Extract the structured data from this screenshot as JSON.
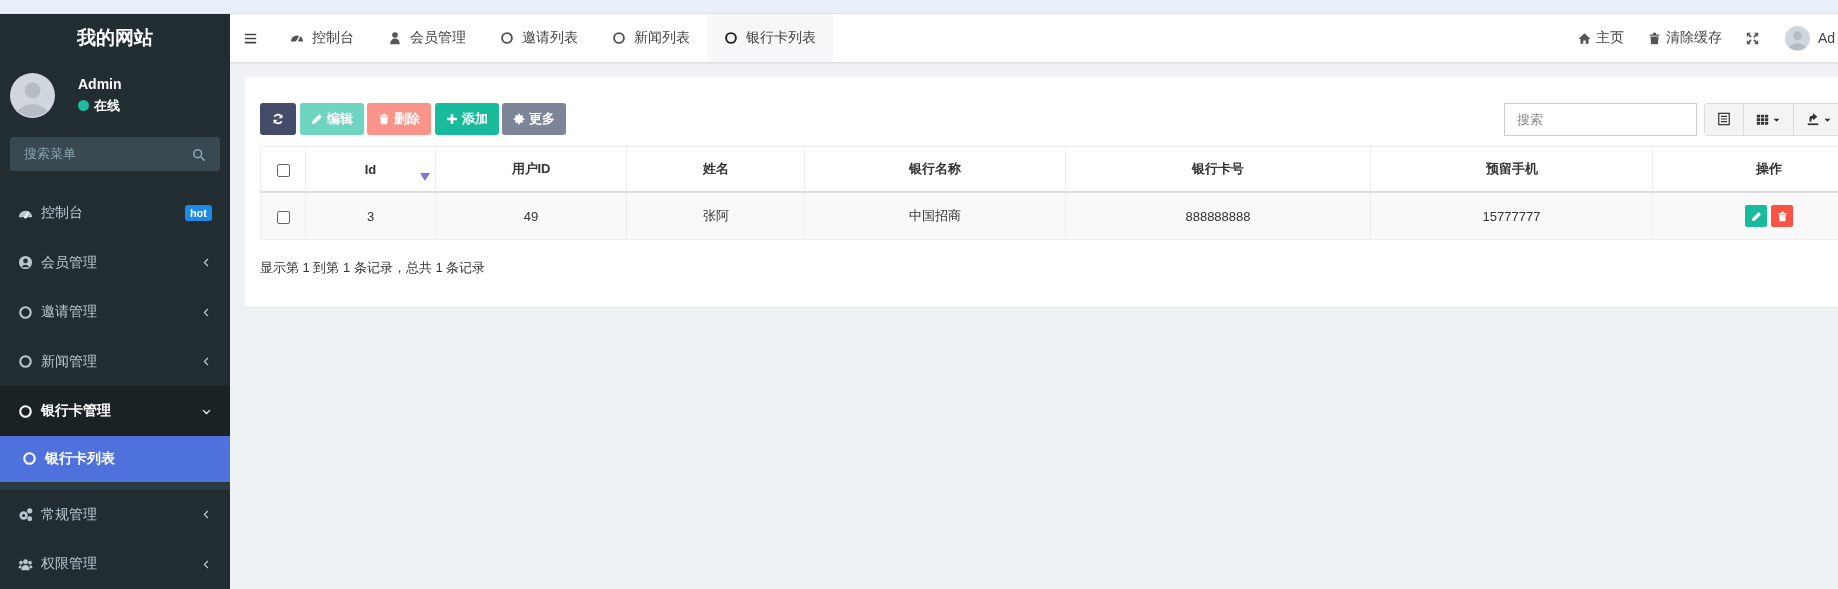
{
  "sidebar": {
    "site_title": "我的网站",
    "user": {
      "name": "Admin",
      "status": "在线"
    },
    "search": {
      "placeholder": "搜索菜单"
    },
    "items": [
      {
        "kind": "link",
        "label": "控制台",
        "badge": "hot",
        "selected": false
      },
      {
        "kind": "group",
        "label": "会员管理",
        "expanded": false,
        "selected": false
      },
      {
        "kind": "group",
        "label": "邀请管理",
        "expanded": false,
        "selected": false
      },
      {
        "kind": "group",
        "label": "新闻管理",
        "expanded": false,
        "selected": false
      },
      {
        "kind": "group",
        "label": "银行卡管理",
        "expanded": true,
        "selected": false,
        "children": [
          {
            "label": "银行卡列表",
            "selected": true
          }
        ]
      },
      {
        "kind": "group",
        "label": "常规管理",
        "expanded": false,
        "selected": false
      },
      {
        "kind": "group",
        "label": "权限管理",
        "expanded": false,
        "selected": false
      }
    ]
  },
  "header": {
    "tabs": [
      {
        "label": "控制台",
        "selected": false
      },
      {
        "label": "会员管理",
        "selected": false
      },
      {
        "label": "邀请列表",
        "selected": false
      },
      {
        "label": "新闻列表",
        "selected": false
      },
      {
        "label": "银行卡列表",
        "selected": true
      }
    ],
    "links": [
      "主页",
      "清除缓存"
    ],
    "user_name": "Ad"
  },
  "toolbar": {
    "buttons": [
      {
        "kind": "refresh",
        "disabled": false
      },
      {
        "kind": "edit",
        "label": "编辑",
        "disabled": true
      },
      {
        "kind": "delete",
        "label": "删除",
        "disabled": true
      },
      {
        "kind": "add",
        "label": "添加",
        "disabled": false
      },
      {
        "kind": "more",
        "label": "更多",
        "disabled": false
      }
    ],
    "search": {
      "placeholder": "搜索"
    }
  },
  "table": {
    "select_all": {
      "checked": false
    },
    "columns": [
      {
        "label": "Id",
        "sorted": true
      },
      {
        "label": "用户ID",
        "sorted": false
      },
      {
        "label": "姓名",
        "sorted": false
      },
      {
        "label": "银行名称",
        "sorted": false
      },
      {
        "label": "银行卡号",
        "sorted": false
      },
      {
        "label": "预留手机",
        "sorted": false
      },
      {
        "label": "操作",
        "sorted": false
      }
    ],
    "rows": [
      {
        "checked": false,
        "cells": [
          "3",
          "49",
          "张阿",
          "中国招商",
          "888888888",
          "15777777"
        ]
      }
    ],
    "summary": "显示第 1 到第 1 条记录，总共 1 条记录"
  }
}
